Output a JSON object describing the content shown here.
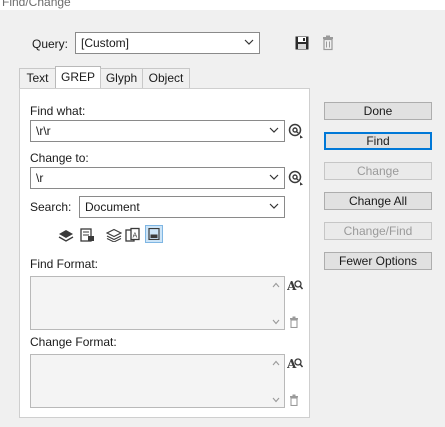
{
  "window": {
    "title": "Find/Change"
  },
  "query": {
    "label": "Query:",
    "value": "[Custom]"
  },
  "tabs": [
    {
      "label": "Text"
    },
    {
      "label": "GREP"
    },
    {
      "label": "Glyph"
    },
    {
      "label": "Object"
    }
  ],
  "find_what": {
    "label": "Find what:",
    "value": "\\r\\r"
  },
  "change_to": {
    "label": "Change to:",
    "value": "\\r"
  },
  "search": {
    "label": "Search:",
    "value": "Document"
  },
  "find_format": {
    "label": "Find Format:"
  },
  "change_format": {
    "label": "Change Format:"
  },
  "buttons": {
    "done": "Done",
    "find": "Find",
    "change": "Change",
    "change_all": "Change All",
    "change_find": "Change/Find",
    "fewer_options": "Fewer Options"
  },
  "colors": {
    "accent": "#0078d7",
    "panel": "#ffffff",
    "dialog": "#f0f0f0",
    "icon": "#3a3a3a"
  }
}
